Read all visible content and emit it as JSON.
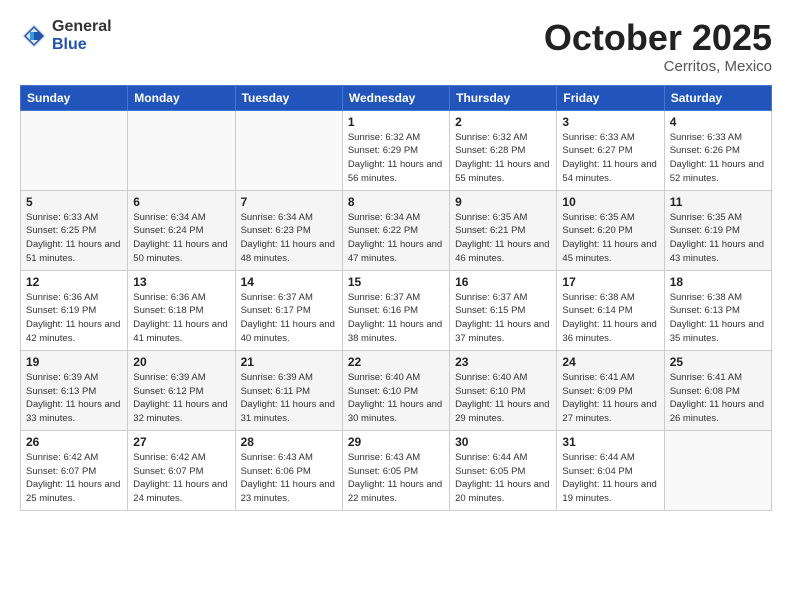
{
  "logo": {
    "general": "General",
    "blue": "Blue"
  },
  "header": {
    "month": "October 2025",
    "location": "Cerritos, Mexico"
  },
  "weekdays": [
    "Sunday",
    "Monday",
    "Tuesday",
    "Wednesday",
    "Thursday",
    "Friday",
    "Saturday"
  ],
  "weeks": [
    [
      {
        "day": "",
        "info": ""
      },
      {
        "day": "",
        "info": ""
      },
      {
        "day": "",
        "info": ""
      },
      {
        "day": "1",
        "info": "Sunrise: 6:32 AM\nSunset: 6:29 PM\nDaylight: 11 hours\nand 56 minutes."
      },
      {
        "day": "2",
        "info": "Sunrise: 6:32 AM\nSunset: 6:28 PM\nDaylight: 11 hours\nand 55 minutes."
      },
      {
        "day": "3",
        "info": "Sunrise: 6:33 AM\nSunset: 6:27 PM\nDaylight: 11 hours\nand 54 minutes."
      },
      {
        "day": "4",
        "info": "Sunrise: 6:33 AM\nSunset: 6:26 PM\nDaylight: 11 hours\nand 52 minutes."
      }
    ],
    [
      {
        "day": "5",
        "info": "Sunrise: 6:33 AM\nSunset: 6:25 PM\nDaylight: 11 hours\nand 51 minutes."
      },
      {
        "day": "6",
        "info": "Sunrise: 6:34 AM\nSunset: 6:24 PM\nDaylight: 11 hours\nand 50 minutes."
      },
      {
        "day": "7",
        "info": "Sunrise: 6:34 AM\nSunset: 6:23 PM\nDaylight: 11 hours\nand 48 minutes."
      },
      {
        "day": "8",
        "info": "Sunrise: 6:34 AM\nSunset: 6:22 PM\nDaylight: 11 hours\nand 47 minutes."
      },
      {
        "day": "9",
        "info": "Sunrise: 6:35 AM\nSunset: 6:21 PM\nDaylight: 11 hours\nand 46 minutes."
      },
      {
        "day": "10",
        "info": "Sunrise: 6:35 AM\nSunset: 6:20 PM\nDaylight: 11 hours\nand 45 minutes."
      },
      {
        "day": "11",
        "info": "Sunrise: 6:35 AM\nSunset: 6:19 PM\nDaylight: 11 hours\nand 43 minutes."
      }
    ],
    [
      {
        "day": "12",
        "info": "Sunrise: 6:36 AM\nSunset: 6:19 PM\nDaylight: 11 hours\nand 42 minutes."
      },
      {
        "day": "13",
        "info": "Sunrise: 6:36 AM\nSunset: 6:18 PM\nDaylight: 11 hours\nand 41 minutes."
      },
      {
        "day": "14",
        "info": "Sunrise: 6:37 AM\nSunset: 6:17 PM\nDaylight: 11 hours\nand 40 minutes."
      },
      {
        "day": "15",
        "info": "Sunrise: 6:37 AM\nSunset: 6:16 PM\nDaylight: 11 hours\nand 38 minutes."
      },
      {
        "day": "16",
        "info": "Sunrise: 6:37 AM\nSunset: 6:15 PM\nDaylight: 11 hours\nand 37 minutes."
      },
      {
        "day": "17",
        "info": "Sunrise: 6:38 AM\nSunset: 6:14 PM\nDaylight: 11 hours\nand 36 minutes."
      },
      {
        "day": "18",
        "info": "Sunrise: 6:38 AM\nSunset: 6:13 PM\nDaylight: 11 hours\nand 35 minutes."
      }
    ],
    [
      {
        "day": "19",
        "info": "Sunrise: 6:39 AM\nSunset: 6:13 PM\nDaylight: 11 hours\nand 33 minutes."
      },
      {
        "day": "20",
        "info": "Sunrise: 6:39 AM\nSunset: 6:12 PM\nDaylight: 11 hours\nand 32 minutes."
      },
      {
        "day": "21",
        "info": "Sunrise: 6:39 AM\nSunset: 6:11 PM\nDaylight: 11 hours\nand 31 minutes."
      },
      {
        "day": "22",
        "info": "Sunrise: 6:40 AM\nSunset: 6:10 PM\nDaylight: 11 hours\nand 30 minutes."
      },
      {
        "day": "23",
        "info": "Sunrise: 6:40 AM\nSunset: 6:10 PM\nDaylight: 11 hours\nand 29 minutes."
      },
      {
        "day": "24",
        "info": "Sunrise: 6:41 AM\nSunset: 6:09 PM\nDaylight: 11 hours\nand 27 minutes."
      },
      {
        "day": "25",
        "info": "Sunrise: 6:41 AM\nSunset: 6:08 PM\nDaylight: 11 hours\nand 26 minutes."
      }
    ],
    [
      {
        "day": "26",
        "info": "Sunrise: 6:42 AM\nSunset: 6:07 PM\nDaylight: 11 hours\nand 25 minutes."
      },
      {
        "day": "27",
        "info": "Sunrise: 6:42 AM\nSunset: 6:07 PM\nDaylight: 11 hours\nand 24 minutes."
      },
      {
        "day": "28",
        "info": "Sunrise: 6:43 AM\nSunset: 6:06 PM\nDaylight: 11 hours\nand 23 minutes."
      },
      {
        "day": "29",
        "info": "Sunrise: 6:43 AM\nSunset: 6:05 PM\nDaylight: 11 hours\nand 22 minutes."
      },
      {
        "day": "30",
        "info": "Sunrise: 6:44 AM\nSunset: 6:05 PM\nDaylight: 11 hours\nand 20 minutes."
      },
      {
        "day": "31",
        "info": "Sunrise: 6:44 AM\nSunset: 6:04 PM\nDaylight: 11 hours\nand 19 minutes."
      },
      {
        "day": "",
        "info": ""
      }
    ]
  ]
}
